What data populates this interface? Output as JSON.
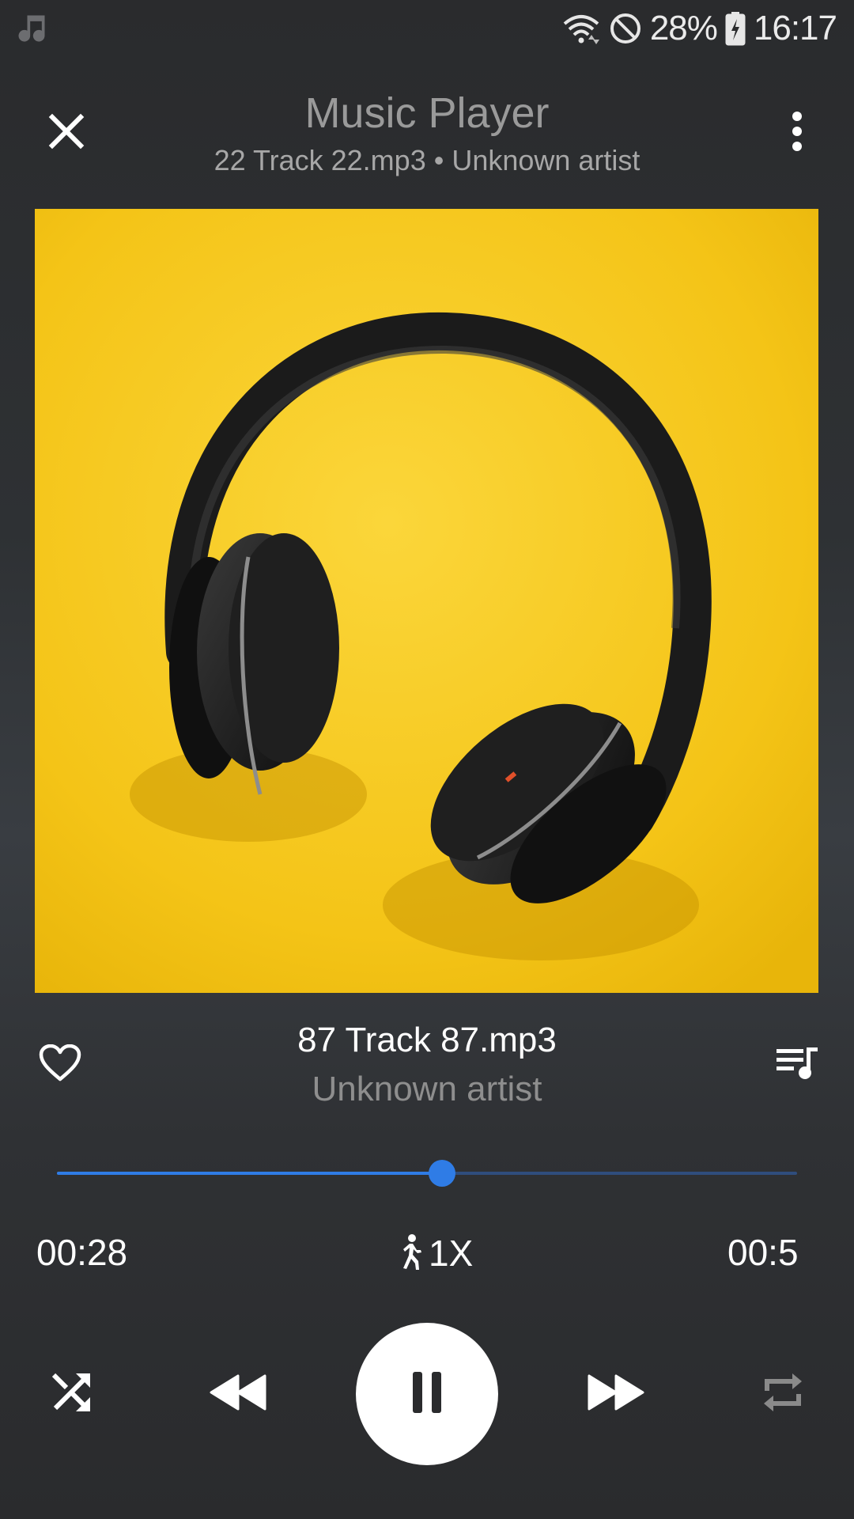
{
  "status_bar": {
    "left_icon": "music-note-icon",
    "icons": [
      "wifi-icon",
      "do-not-disturb-icon",
      "battery-charging-icon"
    ],
    "battery_percent": "28%",
    "time": "16:17"
  },
  "header": {
    "title": "Music Player",
    "subtitle": "22 Track 22.mp3 • Unknown artist",
    "close_icon": "close-icon",
    "more_icon": "more-vertical-icon"
  },
  "artwork": {
    "subject": "headphones-on-yellow",
    "background_color": "#f5c619"
  },
  "now_playing": {
    "title": "87 Track 87.mp3",
    "artist": "Unknown artist",
    "favorite_icon": "heart-outline-icon",
    "queue_icon": "queue-music-icon"
  },
  "progress": {
    "fraction": 0.52,
    "elapsed": "00:28",
    "total": "00:5",
    "speed": "1X",
    "speed_icon": "running-person-icon"
  },
  "controls": {
    "shuffle_icon": "shuffle-icon",
    "previous_icon": "rewind-icon",
    "play_pause_icon": "pause-icon",
    "next_icon": "fast-forward-icon",
    "repeat_icon": "repeat-icon"
  },
  "colors": {
    "accent": "#2f7ce6",
    "track_bg": "#2f4d7d",
    "title_gray": "#9a9a9a",
    "artist_gray": "#8e8e8e"
  }
}
